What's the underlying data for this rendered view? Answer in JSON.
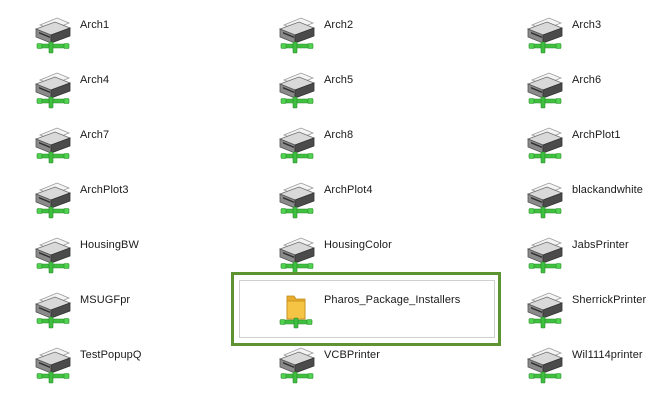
{
  "items": [
    {
      "label": "Arch1",
      "type": "printer"
    },
    {
      "label": "Arch2",
      "type": "printer"
    },
    {
      "label": "Arch3",
      "type": "printer"
    },
    {
      "label": "Arch4",
      "type": "printer"
    },
    {
      "label": "Arch5",
      "type": "printer"
    },
    {
      "label": "Arch6",
      "type": "printer"
    },
    {
      "label": "Arch7",
      "type": "printer"
    },
    {
      "label": "Arch8",
      "type": "printer"
    },
    {
      "label": "ArchPlot1",
      "type": "printer"
    },
    {
      "label": "ArchPlot3",
      "type": "printer"
    },
    {
      "label": "ArchPlot4",
      "type": "printer"
    },
    {
      "label": "blackandwhite",
      "type": "printer"
    },
    {
      "label": "HousingBW",
      "type": "printer"
    },
    {
      "label": "HousingColor",
      "type": "printer"
    },
    {
      "label": "JabsPrinter",
      "type": "printer"
    },
    {
      "label": "MSUGFpr",
      "type": "printer"
    },
    {
      "label": "Pharos_Package_Installers",
      "type": "folder"
    },
    {
      "label": "SherrickPrinter",
      "type": "printer"
    },
    {
      "label": "TestPopupQ",
      "type": "printer"
    },
    {
      "label": "VCBPrinter",
      "type": "printer"
    },
    {
      "label": "Wil1114printer",
      "type": "printer"
    }
  ],
  "icons": {
    "printer": "network-printer-icon",
    "folder": "shared-folder-icon"
  },
  "colors": {
    "highlight_border": "#5e9332",
    "network_green": "#3fbf3f",
    "folder_yellow": "#f5c445"
  }
}
